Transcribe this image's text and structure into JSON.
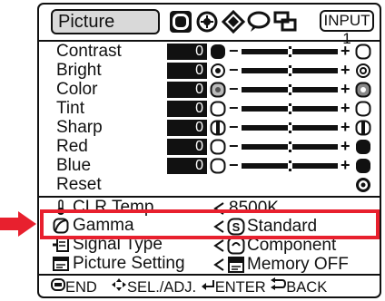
{
  "header": {
    "menu_title": "Picture",
    "tabs": [
      "picture-tab-icon",
      "fine-sync-icon",
      "options-icon",
      "language-icon",
      "display-icon"
    ],
    "input_label": "INPUT 1"
  },
  "adjustments": [
    {
      "label": "Contrast",
      "value": "0",
      "level": 0.5
    },
    {
      "label": "Bright",
      "value": "0",
      "level": 0.5
    },
    {
      "label": "Color",
      "value": "0",
      "level": 0.5
    },
    {
      "label": "Tint",
      "value": "0",
      "level": 0.5
    },
    {
      "label": "Sharp",
      "value": "0",
      "level": 0.5
    },
    {
      "label": "Red",
      "value": "0",
      "level": 0.5
    },
    {
      "label": "Blue",
      "value": "0",
      "level": 0.5
    }
  ],
  "reset": {
    "label": "Reset"
  },
  "settings": [
    {
      "label": "CLR Temp",
      "value": "8500K",
      "icon": "color-temp-icon"
    },
    {
      "label": "Gamma",
      "value": "Standard",
      "icon": "gamma-icon",
      "selected": true
    },
    {
      "label": "Signal Type",
      "value": "Component",
      "icon": "signal-type-icon"
    },
    {
      "label": "Picture Setting",
      "value": "Memory OFF",
      "icon": "picture-setting-icon"
    }
  ],
  "footer": {
    "end": "END",
    "sel": "SEL./ADJ.",
    "enter": "ENTER",
    "back": "BACK"
  },
  "colors": {
    "highlight": "#e8202e",
    "pointer": "#e8202e",
    "value_bg": "#111111",
    "tab_bg": "#d9d9d9"
  }
}
